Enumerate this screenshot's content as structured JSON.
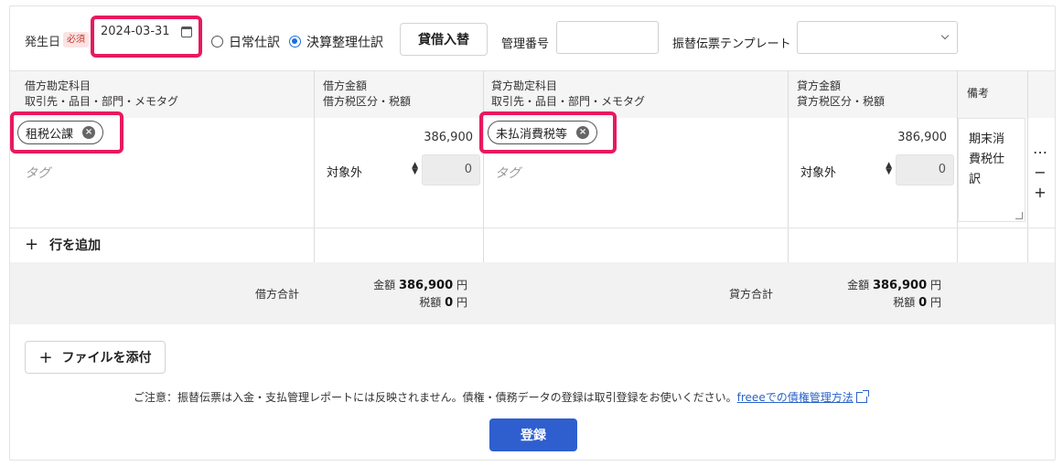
{
  "header": {
    "date_label": "発生日",
    "required_badge": "必須",
    "date_value": "2024-03-31",
    "radio_normal_label": "日常仕訳",
    "radio_closing_label": "決算整理仕訳",
    "swap_button": "貸借入替",
    "mgmt_no_label": "管理番号",
    "mgmt_no_value": "",
    "template_label": "振替伝票テンプレート",
    "template_value": ""
  },
  "table": {
    "columns": {
      "debit_account": "借方勘定科目",
      "debit_account_sub": "取引先・品目・部門・メモタグ",
      "debit_amount": "借方金額",
      "debit_amount_sub": "借方税区分・税額",
      "credit_account": "貸方勘定科目",
      "credit_account_sub": "取引先・品目・部門・メモタグ",
      "credit_amount": "貸方金額",
      "credit_amount_sub": "貸方税区分・税額",
      "memo": "備考"
    },
    "row": {
      "debit_account": "租税公課",
      "debit_tag_placeholder": "タグ",
      "debit_amount": "386,900",
      "debit_tax_category": "対象外",
      "debit_tax_amount": "0",
      "credit_account": "未払消費税等",
      "credit_tag_placeholder": "タグ",
      "credit_amount": "386,900",
      "credit_tax_category": "対象外",
      "credit_tax_amount": "0",
      "memo": "期末消費税仕訳"
    },
    "add_row": "行を追加",
    "row_actions": {
      "more": "…",
      "remove": "−",
      "add": "+"
    }
  },
  "totals": {
    "debit_label": "借方合計",
    "debit_amount_label": "金額",
    "debit_amount": "386,900",
    "debit_tax_label": "税額",
    "debit_tax": "0",
    "credit_label": "貸方合計",
    "credit_amount_label": "金額",
    "credit_amount": "386,900",
    "credit_tax_label": "税額",
    "credit_tax": "0",
    "currency": "円"
  },
  "footer": {
    "attach_button": "ファイルを添付",
    "notice_text": "ご注意：振替伝票は入金・支払管理レポートには反映されません。債権・債務データの登録は取引登録をお使いください。",
    "notice_link": "freeeでの債権管理方法",
    "submit_button": "登録"
  },
  "colors": {
    "highlight": "#e8195e",
    "primary": "#2f5fcf",
    "link": "#2a63c7"
  }
}
